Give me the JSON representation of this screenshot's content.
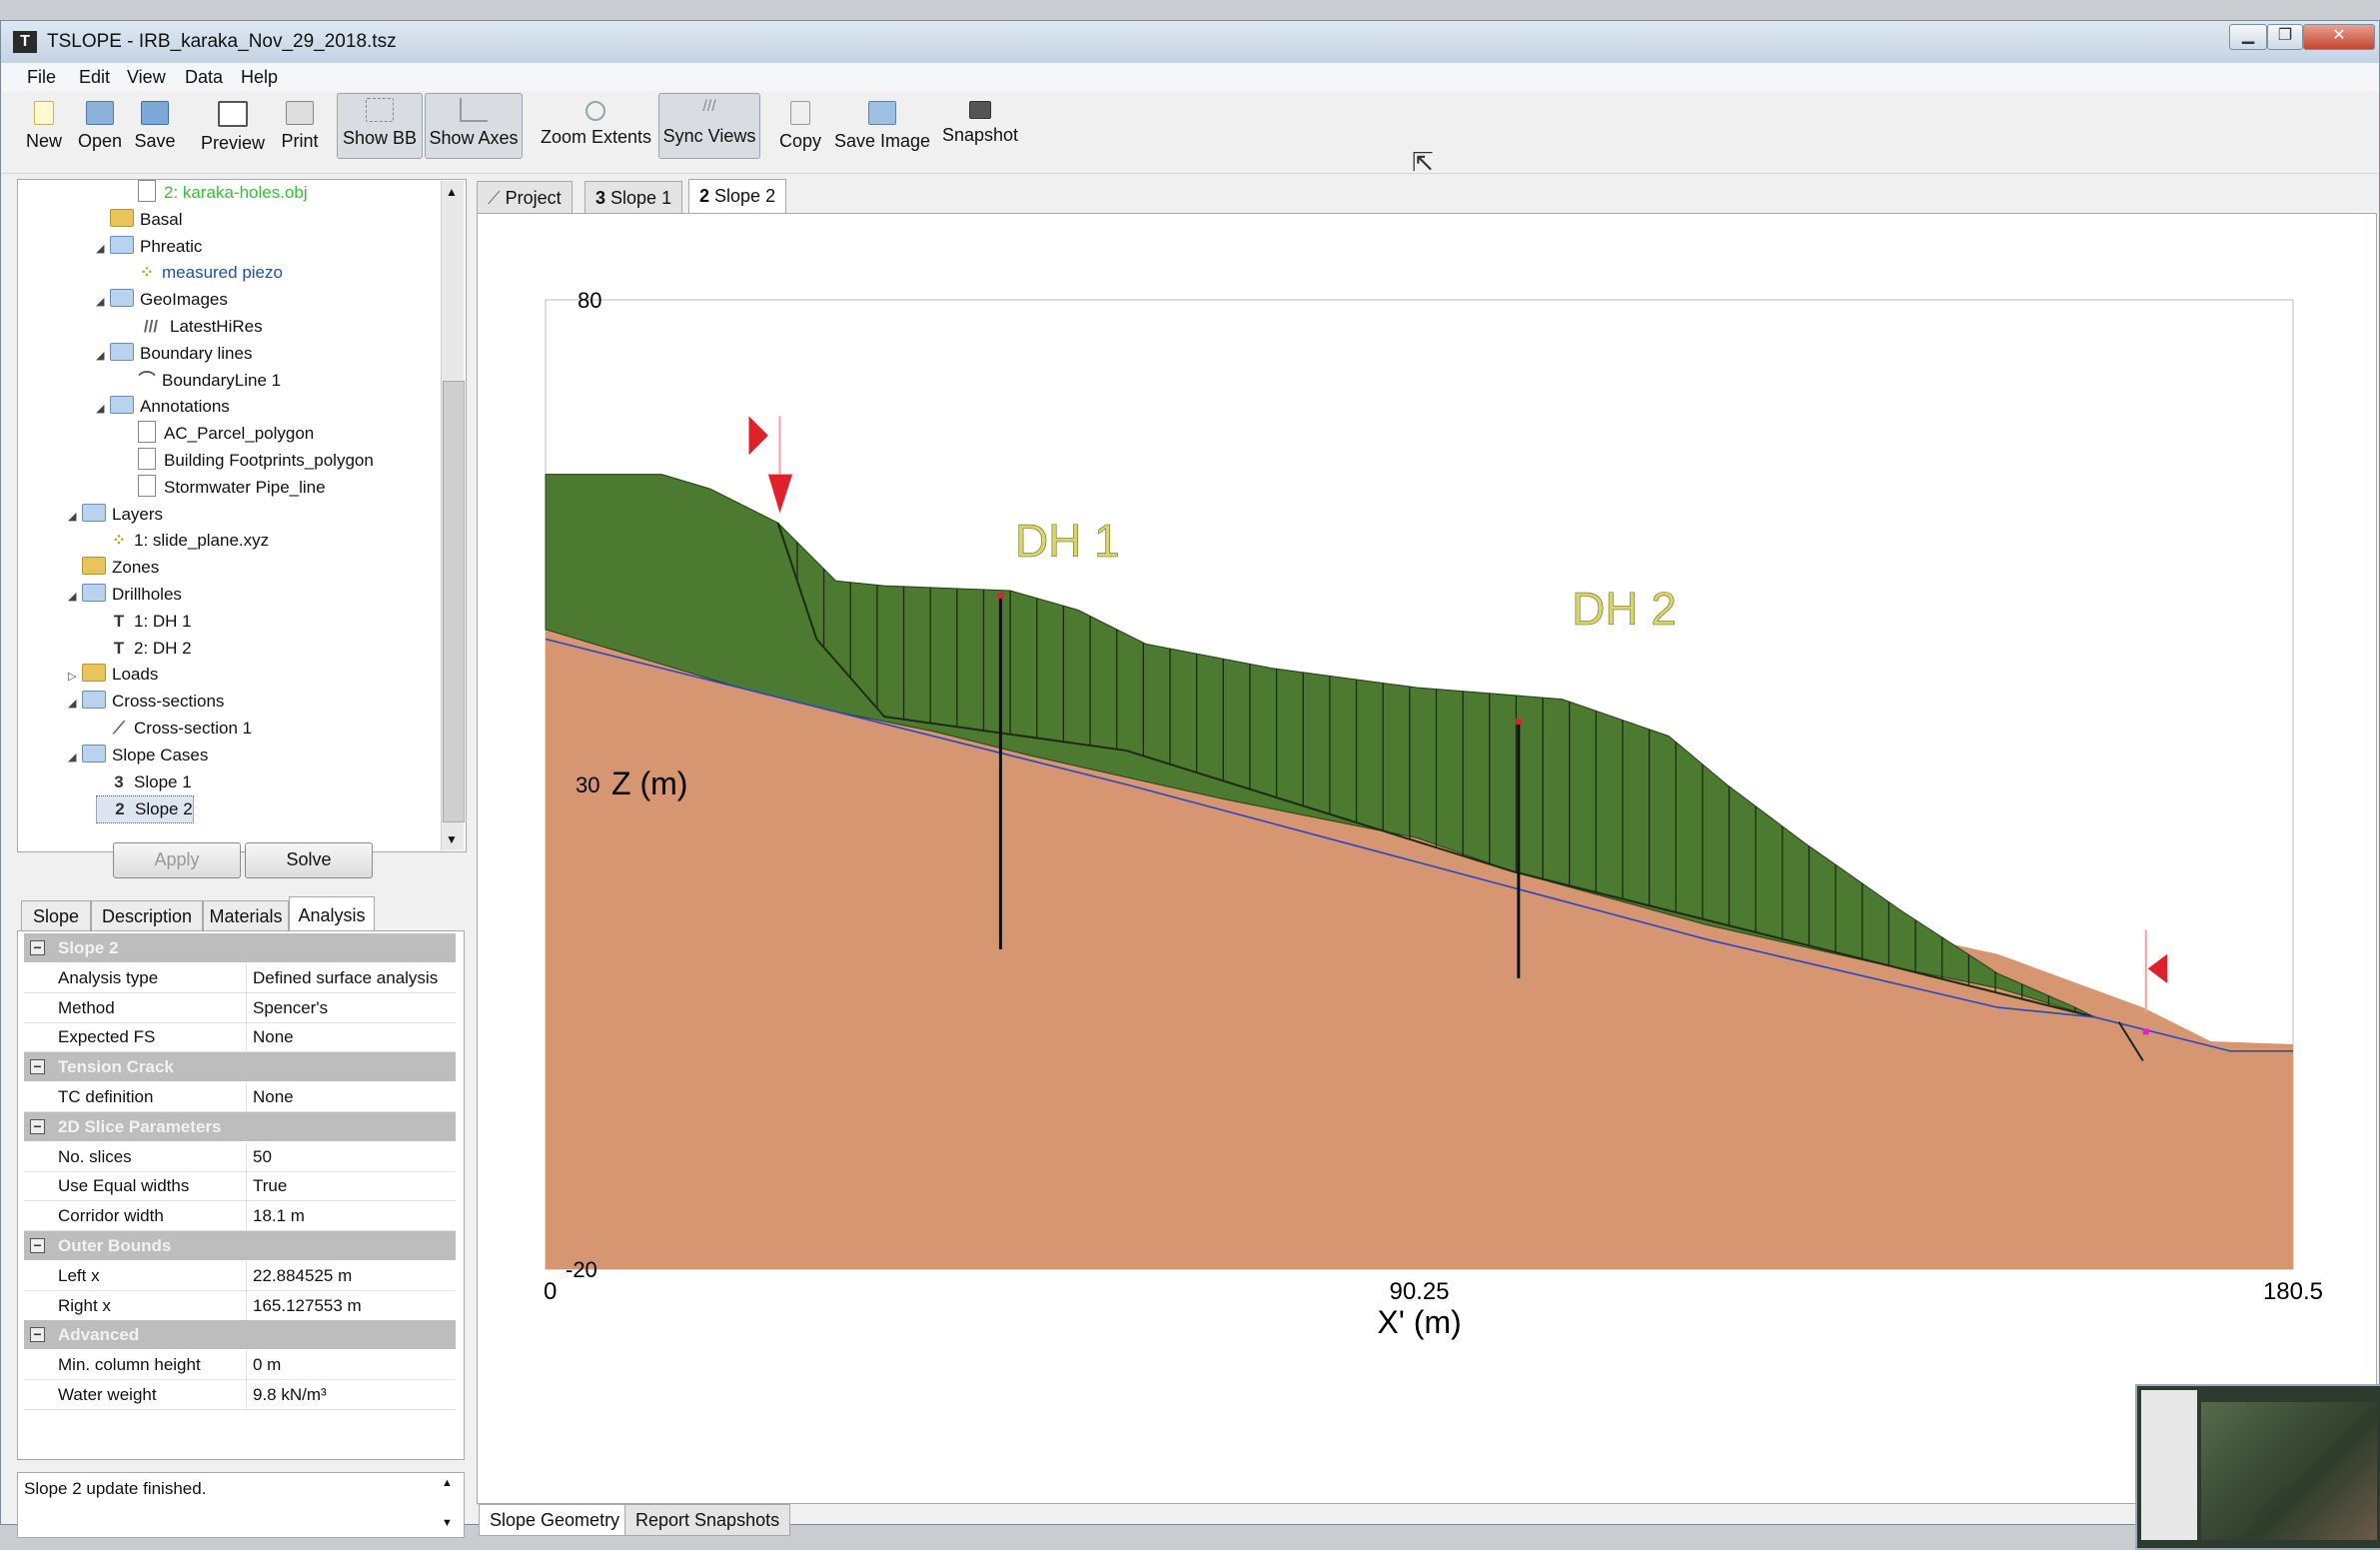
{
  "window": {
    "title": "TSLOPE - IRB_karaka_Nov_29_2018.tsz",
    "app_icon": "T"
  },
  "menu": [
    "File",
    "Edit",
    "View",
    "Data",
    "Help"
  ],
  "toolbar": {
    "new": "New",
    "open": "Open",
    "save": "Save",
    "preview": "Preview",
    "print": "Print",
    "show_bb": "Show BB",
    "show_axes": "Show Axes",
    "zoom_extents": "Zoom Extents",
    "sync_views": "Sync Views",
    "copy": "Copy",
    "save_image": "Save Image",
    "snapshot": "Snapshot"
  },
  "tree": [
    {
      "label": "2: karaka-holes.obj",
      "kind": "doc",
      "indent": 3,
      "color": "#35c03a"
    },
    {
      "label": "Basal",
      "kind": "folder",
      "indent": 2
    },
    {
      "label": "Phreatic",
      "kind": "folder-blue",
      "indent": 2,
      "expanded": true
    },
    {
      "label": "measured piezo",
      "kind": "pt",
      "indent": 3,
      "color": "#1f4fb0"
    },
    {
      "label": "GeoImages",
      "kind": "folder-blue",
      "indent": 2,
      "expanded": true
    },
    {
      "label": "LatestHiRes",
      "kind": "img",
      "indent": 3
    },
    {
      "label": "Boundary lines",
      "kind": "folder-blue",
      "indent": 2,
      "expanded": true
    },
    {
      "label": "BoundaryLine 1",
      "kind": "bl",
      "indent": 3
    },
    {
      "label": "Annotations",
      "kind": "folder-blue",
      "indent": 2,
      "expanded": true
    },
    {
      "label": "AC_Parcel_polygon",
      "kind": "doc",
      "indent": 3
    },
    {
      "label": "Building Footprints_polygon",
      "kind": "doc",
      "indent": 3
    },
    {
      "label": "Stormwater Pipe_line",
      "kind": "doc",
      "indent": 3
    },
    {
      "label": "Layers",
      "kind": "folder-blue",
      "indent": 1,
      "expanded": true
    },
    {
      "label": "1: slide_plane.xyz",
      "kind": "pt",
      "indent": 2
    },
    {
      "label": "Zones",
      "kind": "folder",
      "indent": 1
    },
    {
      "label": "Drillholes",
      "kind": "folder-blue",
      "indent": 1,
      "expanded": true
    },
    {
      "label": "1: DH 1",
      "kind": "dh",
      "indent": 2
    },
    {
      "label": "2: DH 2",
      "kind": "dh",
      "indent": 2
    },
    {
      "label": "Loads",
      "kind": "folder",
      "indent": 1,
      "collapsed": true
    },
    {
      "label": "Cross-sections",
      "kind": "folder-blue",
      "indent": 1,
      "expanded": true
    },
    {
      "label": "Cross-section 1",
      "kind": "line",
      "indent": 2
    },
    {
      "label": "Slope Cases",
      "kind": "folder-blue",
      "indent": 1,
      "expanded": true
    },
    {
      "label": "Slope 1",
      "kind": "num3",
      "indent": 2
    },
    {
      "label": "Slope 2",
      "kind": "num2",
      "indent": 2,
      "selected": true
    }
  ],
  "actions": {
    "apply": "Apply",
    "solve": "Solve"
  },
  "prop_tabs": [
    "Slope",
    "Description",
    "Materials",
    "Analysis"
  ],
  "properties": [
    {
      "section": "Slope 2"
    },
    {
      "key": "Analysis type",
      "value": "Defined surface analysis"
    },
    {
      "key": "Method",
      "value": "Spencer's"
    },
    {
      "key": "Expected FS",
      "value": "None"
    },
    {
      "section": "Tension Crack"
    },
    {
      "key": "TC definition",
      "value": "None"
    },
    {
      "section": "2D Slice Parameters"
    },
    {
      "key": "No. slices",
      "value": "50"
    },
    {
      "key": "Use Equal widths",
      "value": "True"
    },
    {
      "key": "Corridor width",
      "value": "18.1 m"
    },
    {
      "section": "Outer Bounds"
    },
    {
      "key": "Left x",
      "value": "22.884525 m"
    },
    {
      "key": "Right x",
      "value": "165.127553 m"
    },
    {
      "section": "Advanced"
    },
    {
      "key": "Min. column height",
      "value": "0 m"
    },
    {
      "key": "Water weight",
      "value": "9.8 kN/m³"
    }
  ],
  "status": "Slope 2 update finished.",
  "doc_tabs": [
    {
      "label": "Project",
      "icon": "project"
    },
    {
      "label": "Slope 1",
      "icon": "3"
    },
    {
      "label": "Slope 2",
      "icon": "2"
    }
  ],
  "bottom_tabs": [
    "Slope Geometry",
    "Report Snapshots"
  ],
  "plot": {
    "x_axis": {
      "label": "X' (m)",
      "ticks": [
        "0",
        "90.25",
        "180.5"
      ],
      "min": 0,
      "max": 180.5
    },
    "z_axis": {
      "label": "Z (m)",
      "ticks": [
        "80",
        "30",
        "-20"
      ],
      "min": -20,
      "max": 80
    },
    "drillhole_labels": [
      "DH 1",
      "DH 2"
    ],
    "colors": {
      "slide_mass": "#4b7a30",
      "base": "#d69672",
      "water_line": "#2b44c8",
      "marker": "#e0202a",
      "dh_label": "#d8d66a"
    }
  }
}
